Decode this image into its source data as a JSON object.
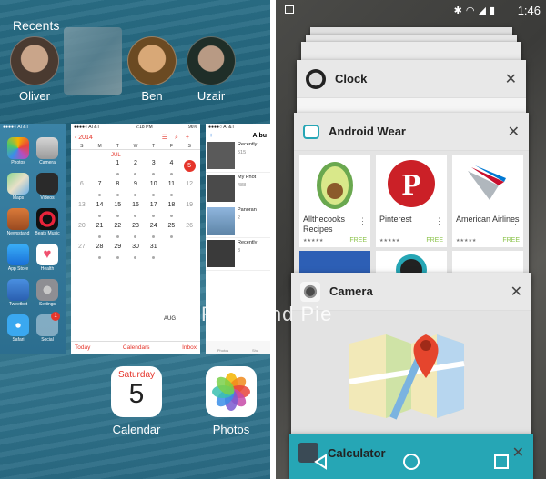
{
  "ios": {
    "recents_label": "Recents",
    "contacts": [
      {
        "name": "Oliver",
        "color": "#6b5a4e"
      },
      {
        "name": "Ben",
        "color": "#8a6a3a"
      },
      {
        "name": "Uzair",
        "color": "#2f4a3f"
      }
    ],
    "home_card": {
      "status_left": "●●●●○ AT&T",
      "apps": [
        {
          "label": "Photos",
          "icon": "photos-icon",
          "color": "#ffffff"
        },
        {
          "label": "Camera",
          "icon": "camera-icon",
          "color": "#c7c7c7"
        },
        {
          "label": "Maps",
          "icon": "maps-icon",
          "color": "#6fcf6f"
        },
        {
          "label": "Videos",
          "icon": "videos-icon",
          "color": "#2a2a2a"
        },
        {
          "label": "Newsstand",
          "icon": "newsstand-icon",
          "color": "#c05b2a"
        },
        {
          "label": "Beats Music",
          "icon": "beats-music-icon",
          "color": "#111111"
        },
        {
          "label": "App Store",
          "icon": "app-store-icon",
          "color": "#2a8ee8"
        },
        {
          "label": "Health",
          "icon": "health-icon",
          "color": "#ffffff"
        },
        {
          "label": "Tweetbot",
          "icon": "tweetbot-icon",
          "color": "#2a6fc7"
        },
        {
          "label": "Settings",
          "icon": "settings-icon",
          "color": "#8e8e93"
        },
        {
          "label": "Safari",
          "icon": "safari-icon",
          "color": "#2a9ee8"
        },
        {
          "label": "Social",
          "icon": "social-folder-icon",
          "color": "#7ca6c0"
        }
      ],
      "social_badge": "1"
    },
    "calendar_card": {
      "status_left": "●●●●○ AT&T",
      "status_time": "2:18 PM",
      "status_right": "96%",
      "back_label": "2014",
      "dow": [
        "S",
        "M",
        "T",
        "W",
        "T",
        "F",
        "S"
      ],
      "month_label": "JUL",
      "weeks": [
        [
          "",
          "",
          "1",
          "2",
          "3",
          "4",
          "5"
        ],
        [
          "6",
          "7",
          "8",
          "9",
          "10",
          "11",
          "12"
        ],
        [
          "13",
          "14",
          "15",
          "16",
          "17",
          "18",
          "19"
        ],
        [
          "20",
          "21",
          "22",
          "23",
          "24",
          "25",
          "26"
        ],
        [
          "27",
          "28",
          "29",
          "30",
          "31",
          "",
          ""
        ]
      ],
      "next_month_label": "AUG",
      "footer": {
        "today": "Today",
        "calendars": "Calendars",
        "inbox": "Inbox"
      }
    },
    "photos_card": {
      "status_left": "●●●●○ AT&T",
      "title": "Albu",
      "albums": [
        {
          "name": "Recently",
          "count": "515",
          "color": "#5a5a5a"
        },
        {
          "name": "My Phot",
          "count": "488",
          "color": "#4a4a4a"
        },
        {
          "name": "Panoran",
          "count": "2",
          "color": "#6f93b8"
        },
        {
          "name": "Recently",
          "count": "3",
          "color": "#3a3a3a"
        }
      ],
      "footer": [
        "Photos",
        "Sha"
      ]
    },
    "dock": [
      {
        "label": "Calendar",
        "day": "Saturday",
        "number": "5"
      },
      {
        "label": "Photos"
      }
    ]
  },
  "android": {
    "status": {
      "time": "1:46"
    },
    "tasks": {
      "clock": {
        "title": "Clock"
      },
      "android_wear": {
        "title": "Android Wear",
        "apps": [
          {
            "name": "Allthecooks Recipes",
            "badge": "FREE",
            "color": "#6aa84f"
          },
          {
            "name": "Pinterest",
            "badge": "FREE",
            "color": "#cb2027"
          },
          {
            "name": "American Airlines",
            "badge": "FREE",
            "color": "#c8102e"
          }
        ]
      },
      "camera": {
        "title": "Camera"
      },
      "calculator": {
        "title": "Calculator"
      }
    }
  },
  "watermark": "Redmond Pie",
  "colors": {
    "ios_red": "#e5352b",
    "android_teal": "#26a6b5"
  }
}
